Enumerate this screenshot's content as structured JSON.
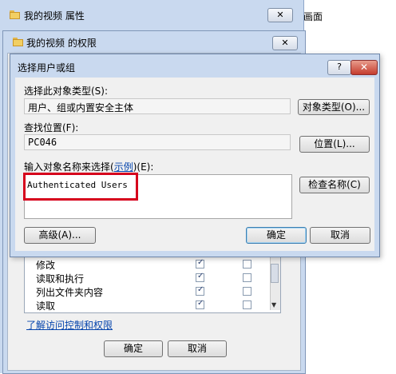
{
  "background_window": {
    "title": "我的视频 属性",
    "close_label": "✕",
    "right_fragment": "画面"
  },
  "permissions_window": {
    "title": "我的视频 的权限",
    "close_label": "✕",
    "permissions": [
      {
        "label": "修改",
        "allow": true,
        "deny": false
      },
      {
        "label": "读取和执行",
        "allow": true,
        "deny": false
      },
      {
        "label": "列出文件夹内容",
        "allow": true,
        "deny": false
      },
      {
        "label": "读取",
        "allow": true,
        "deny": false
      }
    ],
    "link_text": "了解访问控制和权限",
    "ok_label": "确定",
    "cancel_label": "取消"
  },
  "dialog": {
    "title": "选择用户或组",
    "help_label": "?",
    "close_label": "✕",
    "object_type_label": "选择此对象类型(S):",
    "object_type_value": "用户、组或内置安全主体",
    "object_type_button": "对象类型(O)...",
    "location_label": "查找位置(F):",
    "location_value": "PC046",
    "location_button": "位置(L)...",
    "enter_names_prefix": "输入对象名称来选择(",
    "examples_link": "示例",
    "enter_names_suffix": ")(E):",
    "names_value": "Authenticated Users",
    "check_names_button": "检查名称(C)",
    "advanced_button": "高级(A)...",
    "ok_label": "确定",
    "cancel_label": "取消"
  }
}
